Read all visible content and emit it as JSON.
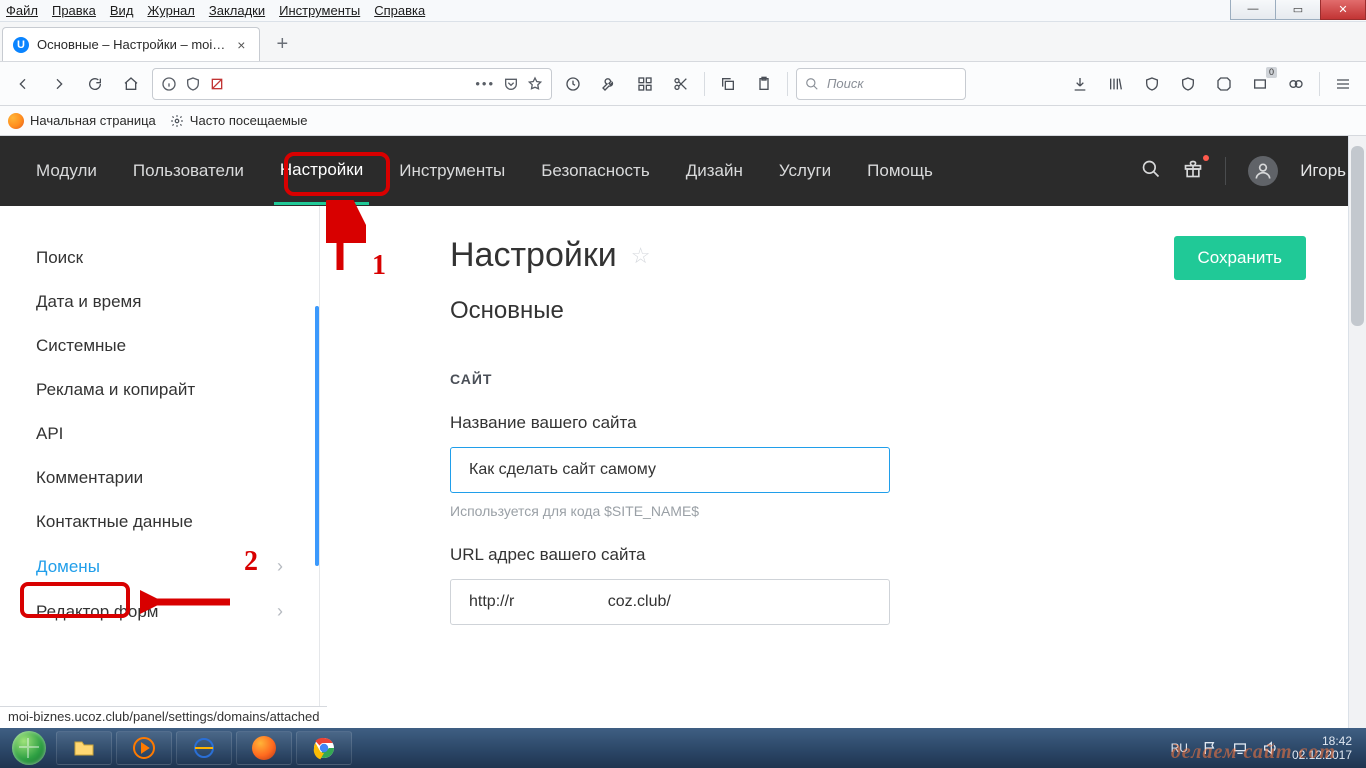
{
  "ff_menu": [
    "Файл",
    "Правка",
    "Вид",
    "Журнал",
    "Закладки",
    "Инструменты",
    "Справка"
  ],
  "tab": {
    "title": "Основные – Настройки – moi…",
    "favicon_letter": "U"
  },
  "search_placeholder": "Поиск",
  "bookmarks": {
    "start": "Начальная страница",
    "freq": "Часто посещаемые"
  },
  "ucoz_nav": [
    "Модули",
    "Пользователи",
    "Настройки",
    "Инструменты",
    "Безопасность",
    "Дизайн",
    "Услуги",
    "Помощь"
  ],
  "ucoz_nav_active_index": 2,
  "user_name": "Игорь",
  "side_items": [
    {
      "label": "Поиск"
    },
    {
      "label": "Дата и время"
    },
    {
      "label": "Системные"
    },
    {
      "label": "Реклама и копирайт"
    },
    {
      "label": "API"
    },
    {
      "label": "Комментарии"
    },
    {
      "label": "Контактные данные"
    },
    {
      "label": "Домены",
      "chev": true,
      "hl": true
    },
    {
      "label": "Редактор форм",
      "chev": true
    }
  ],
  "page_title": "Настройки",
  "subheading": "Основные",
  "save_label": "Сохранить",
  "section_site": "САЙТ",
  "site_name_label": "Название вашего сайта",
  "site_name_value": "Как сделать сайт самому",
  "site_name_hint": "Используется для кода $SITE_NAME$",
  "site_url_label": "URL адрес вашего сайта",
  "site_url_value": "http://r                     coz.club/",
  "status_url": "moi-biznes.ucoz.club/panel/settings/domains/attached",
  "annotations": {
    "n1": "1",
    "n2": "2"
  },
  "tray": {
    "lang": "RU",
    "time": "18:42",
    "date": "02.12.2017"
  },
  "watermark": "делаем сайт com"
}
